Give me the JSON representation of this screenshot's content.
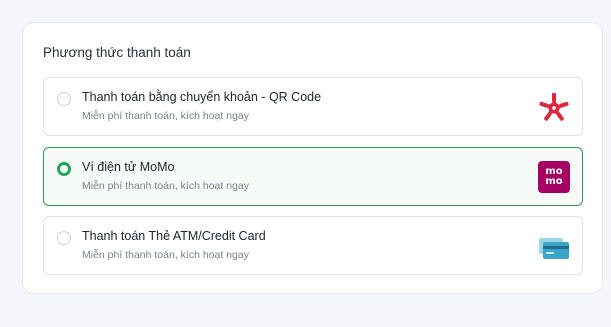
{
  "payment": {
    "title": "Phương thức thanh toán",
    "options": [
      {
        "title": "Thanh toán bằng chuyển khoản - QR Code",
        "subtitle": "Miễn phí thanh toán, kích hoạt ngay",
        "icon": "qr-transfer-logo-icon",
        "selected": false
      },
      {
        "title": "Ví điện tử MoMo",
        "subtitle": "Miễn phí thanh toán, kích hoạt ngay",
        "icon": "momo-logo-icon",
        "logo_text_top": "mo",
        "logo_text_bottom": "mo",
        "selected": true
      },
      {
        "title": "Thanh toán Thẻ ATM/Credit Card",
        "subtitle": "Miễn phí thanh toán, kích hoạt ngay",
        "icon": "credit-card-icon",
        "selected": false
      }
    ]
  },
  "colors": {
    "selected_border": "#2e9d57",
    "radio_checked": "#22a35a",
    "momo_brand": "#a50064",
    "qr_logo": "#e0263f",
    "card_blue": "#3aa6c9"
  }
}
